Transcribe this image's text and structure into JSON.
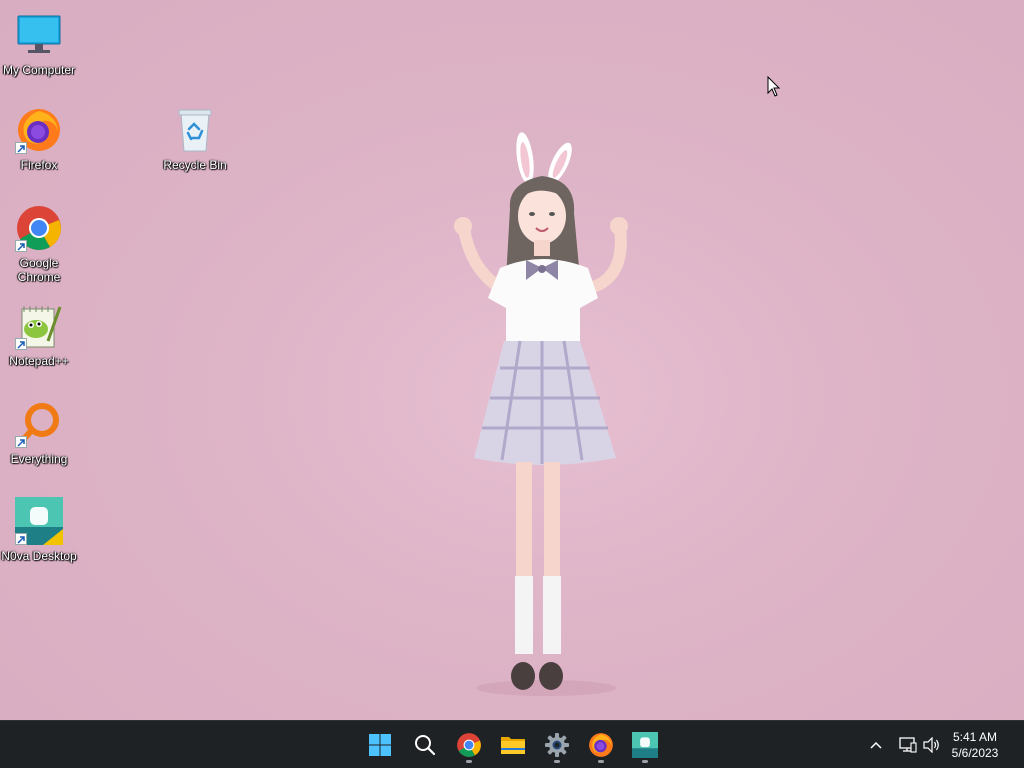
{
  "desktop": {
    "icons": [
      {
        "label": "My Computer",
        "icon": "computer-icon"
      },
      {
        "label": "Firefox",
        "icon": "firefox-icon"
      },
      {
        "label": "Recycle Bin",
        "icon": "recycle-bin-icon"
      },
      {
        "label": "Google Chrome",
        "icon": "chrome-icon"
      },
      {
        "label": "Notepad++",
        "icon": "notepad-plus-plus-icon"
      },
      {
        "label": "Everything",
        "icon": "everything-search-icon"
      },
      {
        "label": "N0va Desktop",
        "icon": "n0va-desktop-icon"
      }
    ],
    "wallpaper_color": "#ddb3c6"
  },
  "taskbar": {
    "background": "#1e2225",
    "apps": [
      {
        "name": "start",
        "icon": "windows-start-icon"
      },
      {
        "name": "search",
        "icon": "search-icon"
      },
      {
        "name": "chrome",
        "icon": "chrome-icon",
        "running": true
      },
      {
        "name": "file-explorer",
        "icon": "folder-icon"
      },
      {
        "name": "settings",
        "icon": "settings-gear-icon",
        "running": true
      },
      {
        "name": "firefox",
        "icon": "firefox-icon",
        "running": true
      },
      {
        "name": "n0va-desktop",
        "icon": "n0va-desktop-icon",
        "running": true
      }
    ],
    "tray": {
      "time": "5:41 AM",
      "date": "5/6/2023"
    }
  }
}
